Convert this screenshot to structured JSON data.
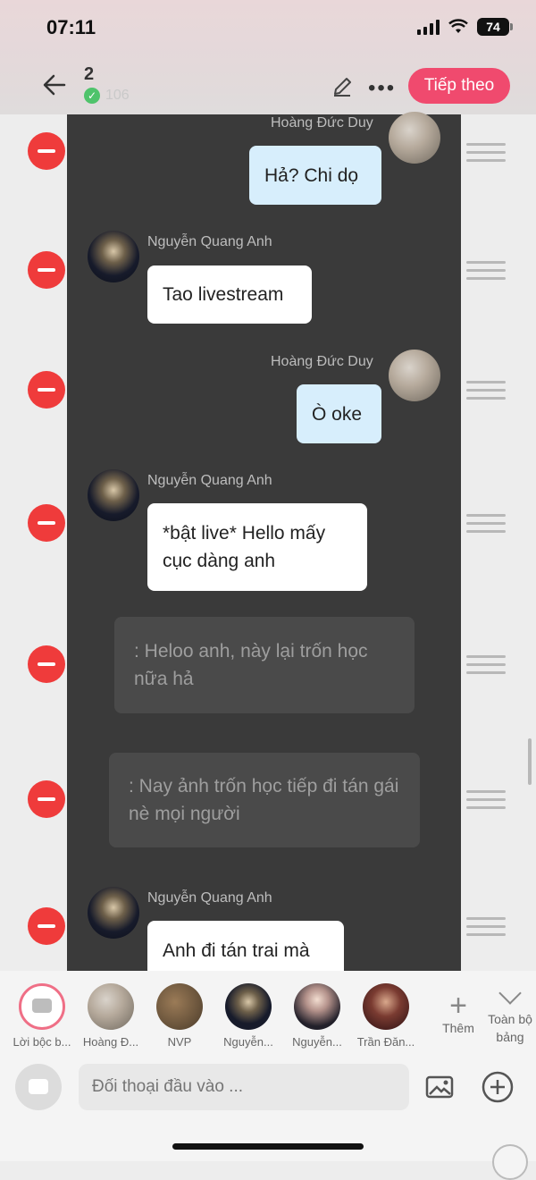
{
  "status": {
    "time": "07:11",
    "battery": "74"
  },
  "header": {
    "chapter_number": "2",
    "subtitle": "106",
    "next_label": "Tiếp theo"
  },
  "messages": [
    {
      "type": "right",
      "sender": "Hoàng Đức Duy",
      "text": "Hả? Chi dọ"
    },
    {
      "type": "left",
      "sender": "Nguyễn Quang Anh",
      "text": "Tao livestream"
    },
    {
      "type": "right",
      "sender": "Hoàng Đức Duy",
      "text": "Ò oke"
    },
    {
      "type": "left",
      "sender": "Nguyễn Quang Anh",
      "text": "*bật live* Hello mấy cục dàng anh"
    },
    {
      "type": "narration",
      "text": ": Heloo anh, này lại trốn học nữa hả"
    },
    {
      "type": "narration",
      "text": ": Nay ảnh trốn học tiếp đi tán gái nè mọi người"
    },
    {
      "type": "left",
      "sender": "Nguyễn Quang Anh",
      "text": "Anh đi tán trai mà"
    }
  ],
  "characters": [
    {
      "name": "Lời bộc b..."
    },
    {
      "name": "Hoàng Đ..."
    },
    {
      "name": "NVP"
    },
    {
      "name": "Nguyễn..."
    },
    {
      "name": "Nguyễn..."
    },
    {
      "name": "Trần Đăn..."
    }
  ],
  "add_character_label": "Thêm",
  "all_board_label": "Toàn bộ bảng",
  "input": {
    "placeholder": "Đối thoại đầu vào ..."
  },
  "colors": {
    "accent": "#f04a6e",
    "delete": "#ef3b3b",
    "chat_bg": "#3a3a3a",
    "bubble_blue": "#d7eefc"
  }
}
